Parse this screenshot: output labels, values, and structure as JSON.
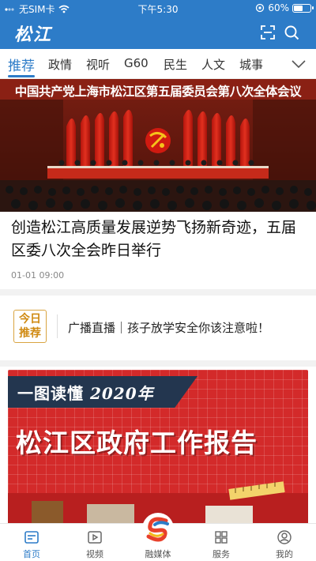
{
  "status_bar": {
    "carrier": "无SIM卡",
    "time": "下午5:30",
    "battery": "60%",
    "battery_level": 0.6
  },
  "header": {
    "logo": "松江"
  },
  "tabs": [
    {
      "label": "推荐",
      "active": true
    },
    {
      "label": "政情"
    },
    {
      "label": "视听"
    },
    {
      "label": "G60"
    },
    {
      "label": "民生"
    },
    {
      "label": "人文"
    },
    {
      "label": "城事"
    }
  ],
  "hero": {
    "headline": "中国共产党上海市松江区第五届委员会第八次全体会议"
  },
  "article": {
    "title": "创造松江高质量发展逆势飞扬新奇迹，五届区委八次全会昨日举行",
    "date": "01-01 09:00"
  },
  "recommend": {
    "badge_line1": "今日",
    "badge_line2": "推荐",
    "text": "广播直播｜孩子放学安全你该注意啦！"
  },
  "banner2": {
    "subtitle": "一图读懂",
    "year": "2020年",
    "title": "松江区政府工作报告"
  },
  "bottom_nav": [
    {
      "label": "首页",
      "icon": "home-icon",
      "active": true
    },
    {
      "label": "视频",
      "icon": "video-icon"
    },
    {
      "label": "融媒体",
      "icon": "media-logo-icon"
    },
    {
      "label": "服务",
      "icon": "grid-icon"
    },
    {
      "label": "我的",
      "icon": "profile-icon"
    }
  ],
  "colors": {
    "primary": "#2d7cc8",
    "banner_red": "#d32a2a",
    "badge_gold": "#d08a12"
  }
}
